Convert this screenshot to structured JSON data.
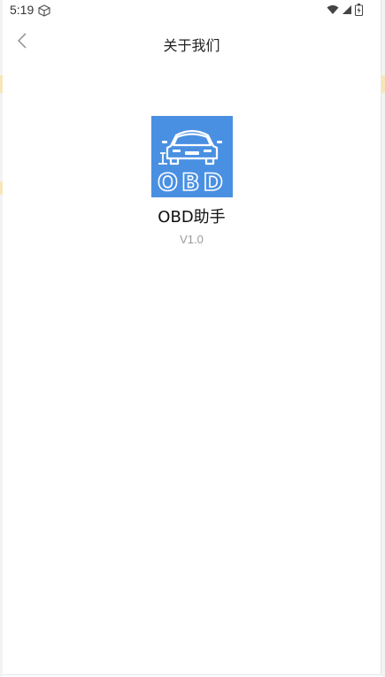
{
  "status_bar": {
    "time": "5:19",
    "icons": [
      "package-icon",
      "wifi-icon",
      "signal-icon",
      "battery-icon"
    ]
  },
  "header": {
    "title": "关于我们",
    "back_icon": "chevron-left-icon"
  },
  "about": {
    "logo_text": "OBD",
    "app_name": "OBD助手",
    "version": "V1.0"
  },
  "colors": {
    "logo_bg": "#4a90e2",
    "version_text": "#9a9a9a",
    "title_text": "#222222"
  }
}
